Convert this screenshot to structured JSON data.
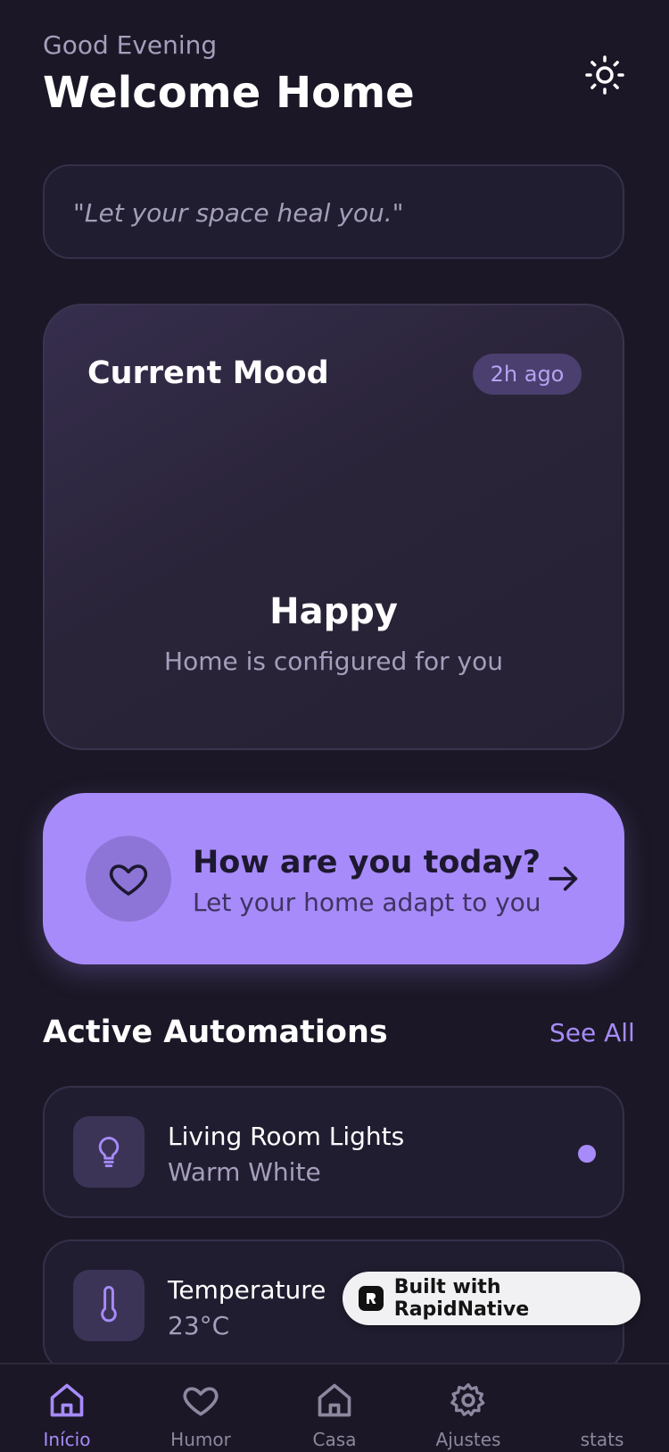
{
  "header": {
    "greeting": "Good Evening",
    "title": "Welcome Home",
    "theme_icon": "sun-icon"
  },
  "quote": {
    "text": "\"Let your space heal you.\""
  },
  "mood_card": {
    "label": "Current Mood",
    "time_ago": "2h ago",
    "mood": "Happy",
    "subtitle": "Home is configured for you"
  },
  "checkin": {
    "title": "How are you today?",
    "subtitle": "Let your home adapt to you",
    "icon": "heart-icon",
    "arrow_icon": "arrow-right-icon"
  },
  "automations": {
    "section_title": "Active Automations",
    "see_all": "See All",
    "items": [
      {
        "name": "Living Room Lights",
        "detail": "Warm White",
        "icon": "lightbulb-icon",
        "active": true
      },
      {
        "name": "Temperature",
        "detail": "23°C",
        "icon": "thermometer-icon",
        "active": true
      }
    ]
  },
  "badge": {
    "text": "Built with RapidNative"
  },
  "tabbar": {
    "tabs": [
      {
        "label": "Início",
        "icon": "home-icon",
        "active": true
      },
      {
        "label": "Humor",
        "icon": "heart-icon",
        "active": false
      },
      {
        "label": "Casa",
        "icon": "house-icon",
        "active": false
      },
      {
        "label": "Ajustes",
        "icon": "gear-icon",
        "active": false
      },
      {
        "label": "stats",
        "icon": "",
        "active": false
      }
    ]
  },
  "colors": {
    "background": "#1b1726",
    "accent": "#a78bfa",
    "card": "#211d30",
    "muted_text": "#a59ebc"
  }
}
